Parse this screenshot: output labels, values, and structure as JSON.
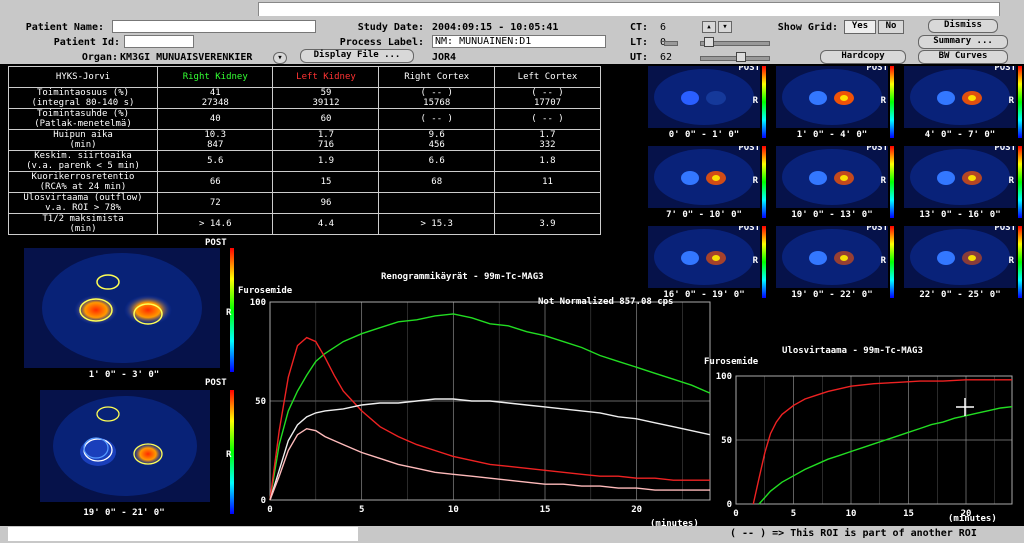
{
  "header": {
    "patient_name_label": "Patient Name:",
    "patient_name": "",
    "patient_id_label": "Patient Id:",
    "patient_id": "",
    "organ_label": "Organ:",
    "organ": "KM3GI MUNUAISVERENKIER",
    "study_date_label": "Study Date:",
    "study_date": "2004:09:15 - 10:05:41",
    "process_label_label": "Process Label:",
    "process_label": "NM: MUNUAINEN:D1",
    "display_file_label": "Display File ...",
    "display_file": "JOR4",
    "ct_label": "CT:",
    "ct_value": "6",
    "lt_label": "LT:",
    "lt_value": "0",
    "ut_label": "UT:",
    "ut_value": "62",
    "show_grid_label": "Show Grid:",
    "yes": "Yes",
    "no": "No",
    "dismiss": "Dismiss",
    "summary": "Summary ...",
    "hardcopy": "Hardcopy",
    "bw_curves": "BW Curves"
  },
  "table": {
    "header": [
      "HYKS-Jorvi",
      "Right Kidney",
      "Left Kidney",
      "Right Cortex",
      "Left Cortex"
    ],
    "header_colors": [
      "#ffffff",
      "#33ff33",
      "#ff3333",
      "#ffffff",
      "#ffffff"
    ],
    "rows": [
      {
        "l1": "Toimintaosuus (%)",
        "l2": "(integral 80-140 s)",
        "c": [
          [
            "41",
            "27348"
          ],
          [
            "59",
            "39112"
          ],
          [
            "( -- )",
            "15768"
          ],
          [
            "( -- )",
            "17707"
          ]
        ]
      },
      {
        "l1": "Toimintasuhde (%)",
        "l2": "(Patlak-menetelmä)",
        "c": [
          [
            "40",
            ""
          ],
          [
            "60",
            ""
          ],
          [
            "( -- )",
            ""
          ],
          [
            "( -- )",
            ""
          ]
        ]
      },
      {
        "l1": "Huipun aika",
        "l2": "(min)",
        "c": [
          [
            "10.3",
            "847"
          ],
          [
            "1.7",
            "716"
          ],
          [
            "9.6",
            "456"
          ],
          [
            "1.7",
            "332"
          ]
        ]
      },
      {
        "l1": "Keskim. siirtoaika",
        "l2": "(v.a. parenk < 5 min)",
        "c": [
          [
            "5.6",
            ""
          ],
          [
            "1.9",
            ""
          ],
          [
            "6.6",
            ""
          ],
          [
            "1.8",
            ""
          ]
        ]
      },
      {
        "l1": "Kuorikerrosretentio",
        "l2": "(RCA% at 24 min)",
        "c": [
          [
            "66",
            ""
          ],
          [
            "15",
            ""
          ],
          [
            "68",
            ""
          ],
          [
            "11",
            ""
          ]
        ]
      },
      {
        "l1": "Ulosvirtaama (outflow)",
        "l2": "v.a. ROI > 78%",
        "c": [
          [
            "72",
            ""
          ],
          [
            "96",
            ""
          ],
          [
            "",
            ""
          ],
          [
            "",
            ""
          ]
        ]
      },
      {
        "l1": "T1/2 maksimista",
        "l2": "(min)",
        "c": [
          [
            "> 14.6",
            ""
          ],
          [
            "4.4",
            ""
          ],
          [
            "> 15.3",
            ""
          ],
          [
            "3.9",
            ""
          ]
        ]
      }
    ]
  },
  "thumbnails": {
    "post": "POST",
    "r": "R",
    "labels": [
      "0' 0\" - 1' 0\"",
      "1' 0\" - 4' 0\"",
      "4' 0\" - 7' 0\"",
      "7' 0\" - 10' 0\"",
      "10' 0\" - 13' 0\"",
      "13' 0\" - 16' 0\"",
      "16' 0\" - 19' 0\"",
      "19' 0\" - 22' 0\"",
      "22' 0\" - 25' 0\""
    ]
  },
  "left_images": {
    "post": "POST",
    "r": "R",
    "label1": "1' 0\" - 3' 0\"",
    "label2": "19' 0\" - 21' 0\""
  },
  "chart_data": [
    {
      "type": "line",
      "title": "Renogrammikäyrät - 99m-Tc-MAG3",
      "subtitle": "Not Normalized 857.08 cps",
      "annotation": "Furosemide",
      "xlabel": "(minutes)",
      "ylabel": "",
      "xlim": [
        0,
        24
      ],
      "ylim": [
        0,
        100
      ],
      "xticks": [
        0,
        5,
        10,
        15,
        20
      ],
      "yticks": [
        0,
        50,
        100
      ],
      "grid": true,
      "series": [
        {
          "color": "#22dd22",
          "x": [
            0,
            0.5,
            1,
            1.5,
            2,
            2.5,
            3,
            4,
            5,
            6,
            7,
            8,
            9,
            10,
            11,
            12,
            13,
            14,
            15,
            16,
            17,
            18,
            19,
            20,
            21,
            22,
            23,
            24
          ],
          "y": [
            0,
            28,
            45,
            55,
            63,
            70,
            74,
            80,
            84,
            87,
            90,
            91,
            93,
            94,
            92,
            89,
            88,
            85,
            83,
            80,
            77,
            73,
            70,
            67,
            64,
            61,
            58,
            54
          ]
        },
        {
          "color": "#ee2222",
          "x": [
            0,
            0.5,
            1,
            1.5,
            2,
            2.5,
            3,
            3.5,
            4,
            5,
            6,
            7,
            8,
            9,
            10,
            11,
            12,
            13,
            14,
            15,
            16,
            17,
            18,
            19,
            20,
            21,
            22,
            23,
            24
          ],
          "y": [
            0,
            35,
            62,
            78,
            82,
            80,
            72,
            63,
            55,
            45,
            37,
            32,
            28,
            25,
            22,
            20,
            18,
            17,
            16,
            15,
            14,
            13,
            12,
            12,
            11,
            11,
            10,
            10,
            10
          ]
        },
        {
          "color": "#eeeeee",
          "x": [
            0,
            0.5,
            1,
            1.5,
            2,
            2.5,
            3,
            4,
            5,
            6,
            7,
            8,
            9,
            10,
            11,
            12,
            13,
            14,
            15,
            16,
            17,
            18,
            19,
            20,
            21,
            22,
            23,
            24
          ],
          "y": [
            0,
            15,
            30,
            38,
            42,
            44,
            45,
            46,
            48,
            49,
            49,
            50,
            51,
            51,
            50,
            50,
            49,
            48,
            47,
            46,
            45,
            44,
            42,
            41,
            39,
            37,
            35,
            33
          ]
        },
        {
          "color": "#ffbbbb",
          "x": [
            0,
            0.5,
            1,
            1.5,
            2,
            2.5,
            3,
            4,
            5,
            6,
            7,
            8,
            9,
            10,
            11,
            12,
            13,
            14,
            15,
            16,
            17,
            18,
            19,
            20,
            21,
            22,
            23,
            24
          ],
          "y": [
            0,
            12,
            25,
            33,
            36,
            35,
            32,
            28,
            24,
            21,
            18,
            16,
            14,
            13,
            12,
            11,
            10,
            9,
            8,
            8,
            7,
            7,
            6,
            6,
            5,
            5,
            5,
            5
          ]
        }
      ]
    },
    {
      "type": "line",
      "title": "Ulosvirtaama - 99m-Tc-MAG3",
      "annotation": "Furosemide",
      "xlabel": "(minutes)",
      "ylabel": "",
      "xlim": [
        0,
        24
      ],
      "ylim": [
        0,
        100
      ],
      "xticks": [
        0,
        5,
        10,
        15,
        20
      ],
      "yticks": [
        0,
        50,
        100
      ],
      "grid": true,
      "series": [
        {
          "color": "#ee2222",
          "x": [
            1.5,
            2,
            2.5,
            3,
            3.5,
            4,
            5,
            6,
            7,
            8,
            9,
            10,
            12,
            14,
            16,
            18,
            20,
            22,
            24
          ],
          "y": [
            0,
            20,
            40,
            55,
            64,
            70,
            77,
            82,
            85,
            88,
            90,
            92,
            94,
            95,
            96,
            96,
            97,
            97,
            97
          ]
        },
        {
          "color": "#22dd22",
          "x": [
            2,
            3,
            4,
            5,
            6,
            7,
            8,
            9,
            10,
            11,
            12,
            13,
            14,
            15,
            16,
            17,
            18,
            19,
            20,
            21,
            22,
            23,
            24
          ],
          "y": [
            0,
            10,
            17,
            22,
            27,
            31,
            35,
            38,
            41,
            44,
            47,
            50,
            53,
            56,
            59,
            62,
            64,
            67,
            69,
            71,
            73,
            75,
            76
          ]
        }
      ]
    }
  ],
  "status": {
    "footer_note": "( -- ) => This ROI is part of another ROI"
  }
}
